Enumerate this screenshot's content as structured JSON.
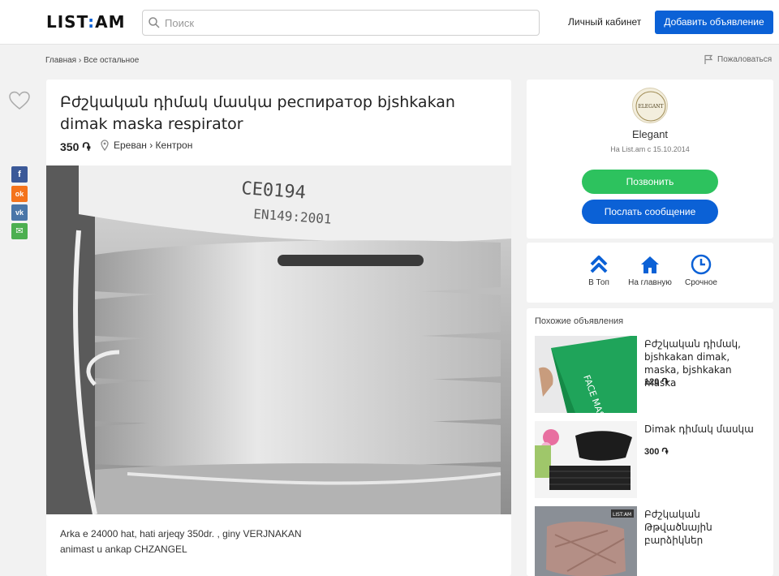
{
  "header": {
    "logo_left": "LIST",
    "logo_mark": ":",
    "logo_right": "AM",
    "search_placeholder": "Поиск",
    "cabinet_label": "Личный кабинет",
    "add_button_label": "Добавить объявление",
    "brand_color": "#0b61d6"
  },
  "breadcrumb": {
    "home": "Главная",
    "separator": "›",
    "category": "Все остальное"
  },
  "complain_label": "Пожаловаться",
  "share": {
    "buttons": [
      {
        "icon": "facebook-icon",
        "glyph": "f",
        "color": "#3b5998"
      },
      {
        "icon": "odnoklassniki-icon",
        "glyph": "ok",
        "color": "#f4731c"
      },
      {
        "icon": "vk-icon",
        "glyph": "vk",
        "color": "#4a76a8"
      },
      {
        "icon": "email-icon",
        "glyph": "✉",
        "color": "#4caf50"
      }
    ]
  },
  "listing": {
    "title": "Բժշկական դիմակ մասկա респиратор bjshkakan dimak maska respirator",
    "price": "350 ֏",
    "location": "Ереван › Кентрон",
    "photo_text_top": "CE0194",
    "photo_text_bottom": "EN149:2001",
    "description_line1": "Arka e 24000 hat, hati arjeqy 350dr. , giny VERJNAKAN",
    "description_line2": "animast u ankap CHZANGEL"
  },
  "seller": {
    "avatar_text": "ELEGANT",
    "name": "Elegant",
    "since": "На List.am с 15.10.2014",
    "call_label": "Позвонить",
    "message_label": "Послать сообщение",
    "call_color": "#2dc25e"
  },
  "promo": [
    {
      "label": "В Топ",
      "icon": "top-arrows-icon"
    },
    {
      "label": "На главную",
      "icon": "home-icon"
    },
    {
      "label": "Срочное",
      "icon": "clock-icon"
    }
  ],
  "similar": {
    "heading": "Похожие объявления",
    "items": [
      {
        "title": "Բժշկական դիմակ, bjshkakan dimak, maska, bjshkakan maska",
        "price": "120 ֏",
        "thumb_text": "FACE MASK"
      },
      {
        "title": "Dimak դիմակ մասկա",
        "price": "300 ֏",
        "thumb_text": ""
      },
      {
        "title": "Բժշկական Թթվածնային բարձիկներ",
        "price": "",
        "thumb_text": "LIST:AM"
      }
    ]
  }
}
